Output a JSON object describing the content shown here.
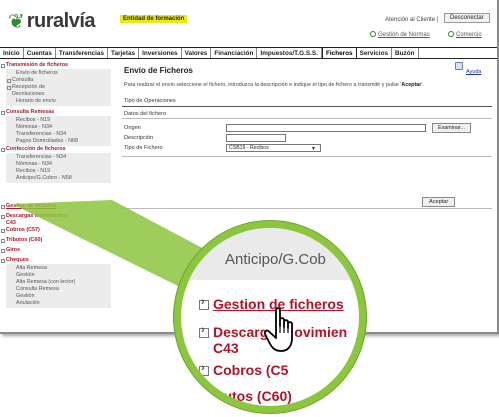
{
  "brand": {
    "logo_text": "ruralvía",
    "entity_badge": "Entidad de formación"
  },
  "header": {
    "attention": "Atención al Cliente |",
    "disconnect": "Desconectar",
    "link_normas": "Gestión de Normas",
    "link_comercio": "Comercio"
  },
  "nav": {
    "tabs": [
      "Inicio",
      "Cuentas",
      "Transferencias",
      "Tarjetas",
      "Inversiones",
      "Valores",
      "Financiación",
      "Impuestos/T.G.S.S.",
      "Ficheros",
      "Servicios",
      "Buzón"
    ],
    "active": "Ficheros"
  },
  "sidebar": {
    "transmision": {
      "title": "Transmisión de ficheros",
      "items": [
        "Envío de ficheros"
      ],
      "subs": [
        "Consulta",
        "Recepción de",
        "Devoluciones"
      ],
      "extra": [
        "Horario de envío"
      ]
    },
    "consulta_remesas": {
      "title": "Consulta Remesas",
      "items": [
        "Recibos - N19",
        "Nóminas - N34",
        "Transferencias - N34",
        "Pagos Domiciliados - N68"
      ]
    },
    "confeccion": {
      "title": "Confección de ficheros",
      "items": [
        "Transferencias - N34",
        "Nóminas - N34",
        "Recibos - N19",
        "Anticipo/G.Cobro - N58"
      ]
    },
    "links": [
      {
        "label": "Gestion de ficheros"
      },
      {
        "label": "Descargas movimientos C43"
      },
      {
        "label": "Cobros (C57)"
      },
      {
        "label": "Tributos (C60)"
      },
      {
        "label": "Giros"
      },
      {
        "label": "Cheques"
      }
    ],
    "cheques_items": [
      "Alta Remesa",
      "Gestión",
      "Alta Remesa (con lector)",
      "Consulta Remesa",
      "Gestión",
      "Anulación"
    ]
  },
  "content": {
    "title": "Envío de Ficheros",
    "help": "Ayuda",
    "intro_text": "Para realizar el envío seleccione el fichero, introduzca la descripción e indique el tipo de fichero a transmitir y pulse '",
    "intro_bold": "Aceptar",
    "intro_end": "'.",
    "tipo_operaciones": "Tipo de Operaciones",
    "datos_fichero": "Datos del fichero",
    "origen_label": "Origen",
    "origen_value": "",
    "browse_label": "Examinar...",
    "descripcion_label": "Descripción",
    "descripcion_value": "",
    "tipo_label": "Tipo de Fichero",
    "tipo_value": "CSB19 - Recibos",
    "accept_label": "Aceptar"
  },
  "magnifier": {
    "anticipo": "Anticipo/G.Cob",
    "gestion": "Gestion de ficheros",
    "descargas_a": "Descarg",
    "descargas_b": "ovimien",
    "descargas_c": "C43",
    "cobros": "Cobros (C5",
    "tributos": "ibutos (C60)"
  },
  "colors": {
    "accent_red": "#b0142a",
    "brand_green": "#2e8b2e",
    "magnifier_ring": "#8cc63f",
    "badge_yellow": "#e6ea1a"
  }
}
